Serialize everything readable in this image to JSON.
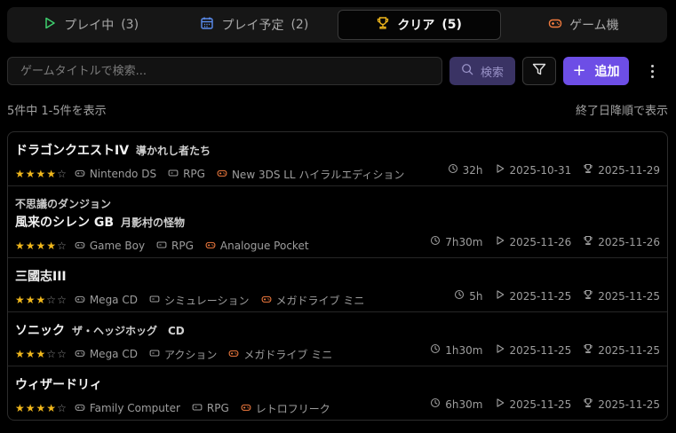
{
  "tabs": [
    {
      "label": "プレイ中",
      "count": "(3)",
      "icon": "play-icon",
      "color": "#3ecf6e"
    },
    {
      "label": "プレイ予定",
      "count": "(2)",
      "icon": "calendar-icon",
      "color": "#5b8def"
    },
    {
      "label": "クリア",
      "count": "(5)",
      "icon": "trophy-icon",
      "color": "#f1b81c",
      "active": true
    },
    {
      "label": "ゲーム機",
      "count": "",
      "icon": "gamepad-icon",
      "color": "#f07a3e"
    }
  ],
  "search": {
    "placeholder": "ゲームタイトルで検索...",
    "value": "",
    "button_label": "検索"
  },
  "toolbar": {
    "add_label": "追加"
  },
  "summary": {
    "count_text": "5件中 1-5件を表示",
    "sort_text": "終了日降順で表示"
  },
  "games": [
    {
      "series": "",
      "title": "ドラゴンクエストIV",
      "subtitle": "導かれし者たち",
      "rating": 4,
      "platform": "Nintendo DS",
      "genre": "RPG",
      "device": "New 3DS LL ハイラルエディション",
      "playtime": "32h",
      "started": "2025-10-31",
      "cleared": "2025-11-29"
    },
    {
      "series": "不思議のダンジョン",
      "title": "風来のシレン GB",
      "subtitle": "月影村の怪物",
      "rating": 4,
      "platform": "Game Boy",
      "genre": "RPG",
      "device": "Analogue Pocket",
      "playtime": "7h30m",
      "started": "2025-11-26",
      "cleared": "2025-11-26"
    },
    {
      "series": "",
      "title": "三國志III",
      "subtitle": "",
      "rating": 3,
      "platform": "Mega CD",
      "genre": "シミュレーション",
      "device": "メガドライブ ミニ",
      "playtime": "5h",
      "started": "2025-11-25",
      "cleared": "2025-11-25"
    },
    {
      "series": "",
      "title": "ソニック",
      "subtitle": "ザ・ヘッジホッグ　CD",
      "rating": 3,
      "platform": "Mega CD",
      "genre": "アクション",
      "device": "メガドライブ ミニ",
      "playtime": "1h30m",
      "started": "2025-11-25",
      "cleared": "2025-11-25"
    },
    {
      "series": "",
      "title": "ウィザードリィ",
      "subtitle": "",
      "rating": 4,
      "platform": "Family Computer",
      "genre": "RPG",
      "device": "レトロフリーク",
      "playtime": "6h30m",
      "started": "2025-11-25",
      "cleared": "2025-11-25"
    }
  ],
  "colors": {
    "accent": "#6d4ee6",
    "device_icon": "#f07a3e",
    "star": "#f1b81c"
  }
}
